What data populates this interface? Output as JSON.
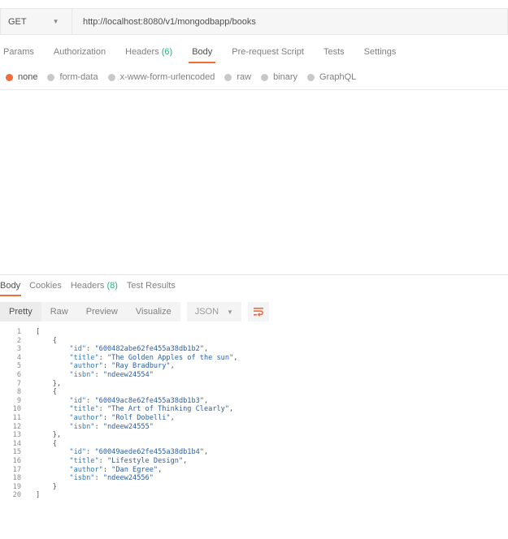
{
  "request": {
    "method": "GET",
    "url": "http://localhost:8080/v1/mongodbapp/books"
  },
  "request_tabs": [
    {
      "label": "Params",
      "count": ""
    },
    {
      "label": "Authorization",
      "count": ""
    },
    {
      "label": "Headers",
      "count": "(6)"
    },
    {
      "label": "Body",
      "count": "",
      "active": true
    },
    {
      "label": "Pre-request Script",
      "count": ""
    },
    {
      "label": "Tests",
      "count": ""
    },
    {
      "label": "Settings",
      "count": ""
    }
  ],
  "body_types": [
    {
      "label": "none",
      "selected": true
    },
    {
      "label": "form-data",
      "selected": false
    },
    {
      "label": "x-www-form-urlencoded",
      "selected": false
    },
    {
      "label": "raw",
      "selected": false
    },
    {
      "label": "binary",
      "selected": false
    },
    {
      "label": "GraphQL",
      "selected": false
    }
  ],
  "response_tabs": [
    {
      "label": "Body",
      "count": "",
      "active": true
    },
    {
      "label": "Cookies",
      "count": ""
    },
    {
      "label": "Headers",
      "count": "(8)"
    },
    {
      "label": "Test Results",
      "count": ""
    }
  ],
  "view_modes": [
    "Pretty",
    "Raw",
    "Preview",
    "Visualize"
  ],
  "active_view": "Pretty",
  "format": "JSON",
  "response_lines": [
    "[",
    "    {",
    "        \"id\": \"600482abe62fe455a38db1b2\",",
    "        \"title\": \"The Golden Apples of the sun\",",
    "        \"author\": \"Ray Bradbury\",",
    "        \"isbn\": \"ndeew24554\"",
    "    },",
    "    {",
    "        \"id\": \"60049ac8e62fe455a38db1b3\",",
    "        \"title\": \"The Art of Thinking Clearly\",",
    "        \"author\": \"Rolf Dobelli\",",
    "        \"isbn\": \"ndeew24555\"",
    "    },",
    "    {",
    "        \"id\": \"60049aede62fe455a38db1b4\",",
    "        \"title\": \"Lifestyle Design\",",
    "        \"author\": \"Dan Egree\",",
    "        \"isbn\": \"ndeew24556\"",
    "    }",
    "]"
  ],
  "line_numbers": [
    "1",
    "2",
    "3",
    "4",
    "5",
    "6",
    "7",
    "8",
    "9",
    "10",
    "11",
    "12",
    "13",
    "14",
    "15",
    "16",
    "17",
    "18",
    "19",
    "20"
  ],
  "colors": {
    "accent": "#f26b3a",
    "count": "#26b47f",
    "json_key": "#3678b8",
    "json_string": "#2a5fa6"
  },
  "icons": {
    "method_dropdown": "chevron-down-icon",
    "format_dropdown": "chevron-down-icon",
    "wrap": "wrap-lines-icon"
  }
}
